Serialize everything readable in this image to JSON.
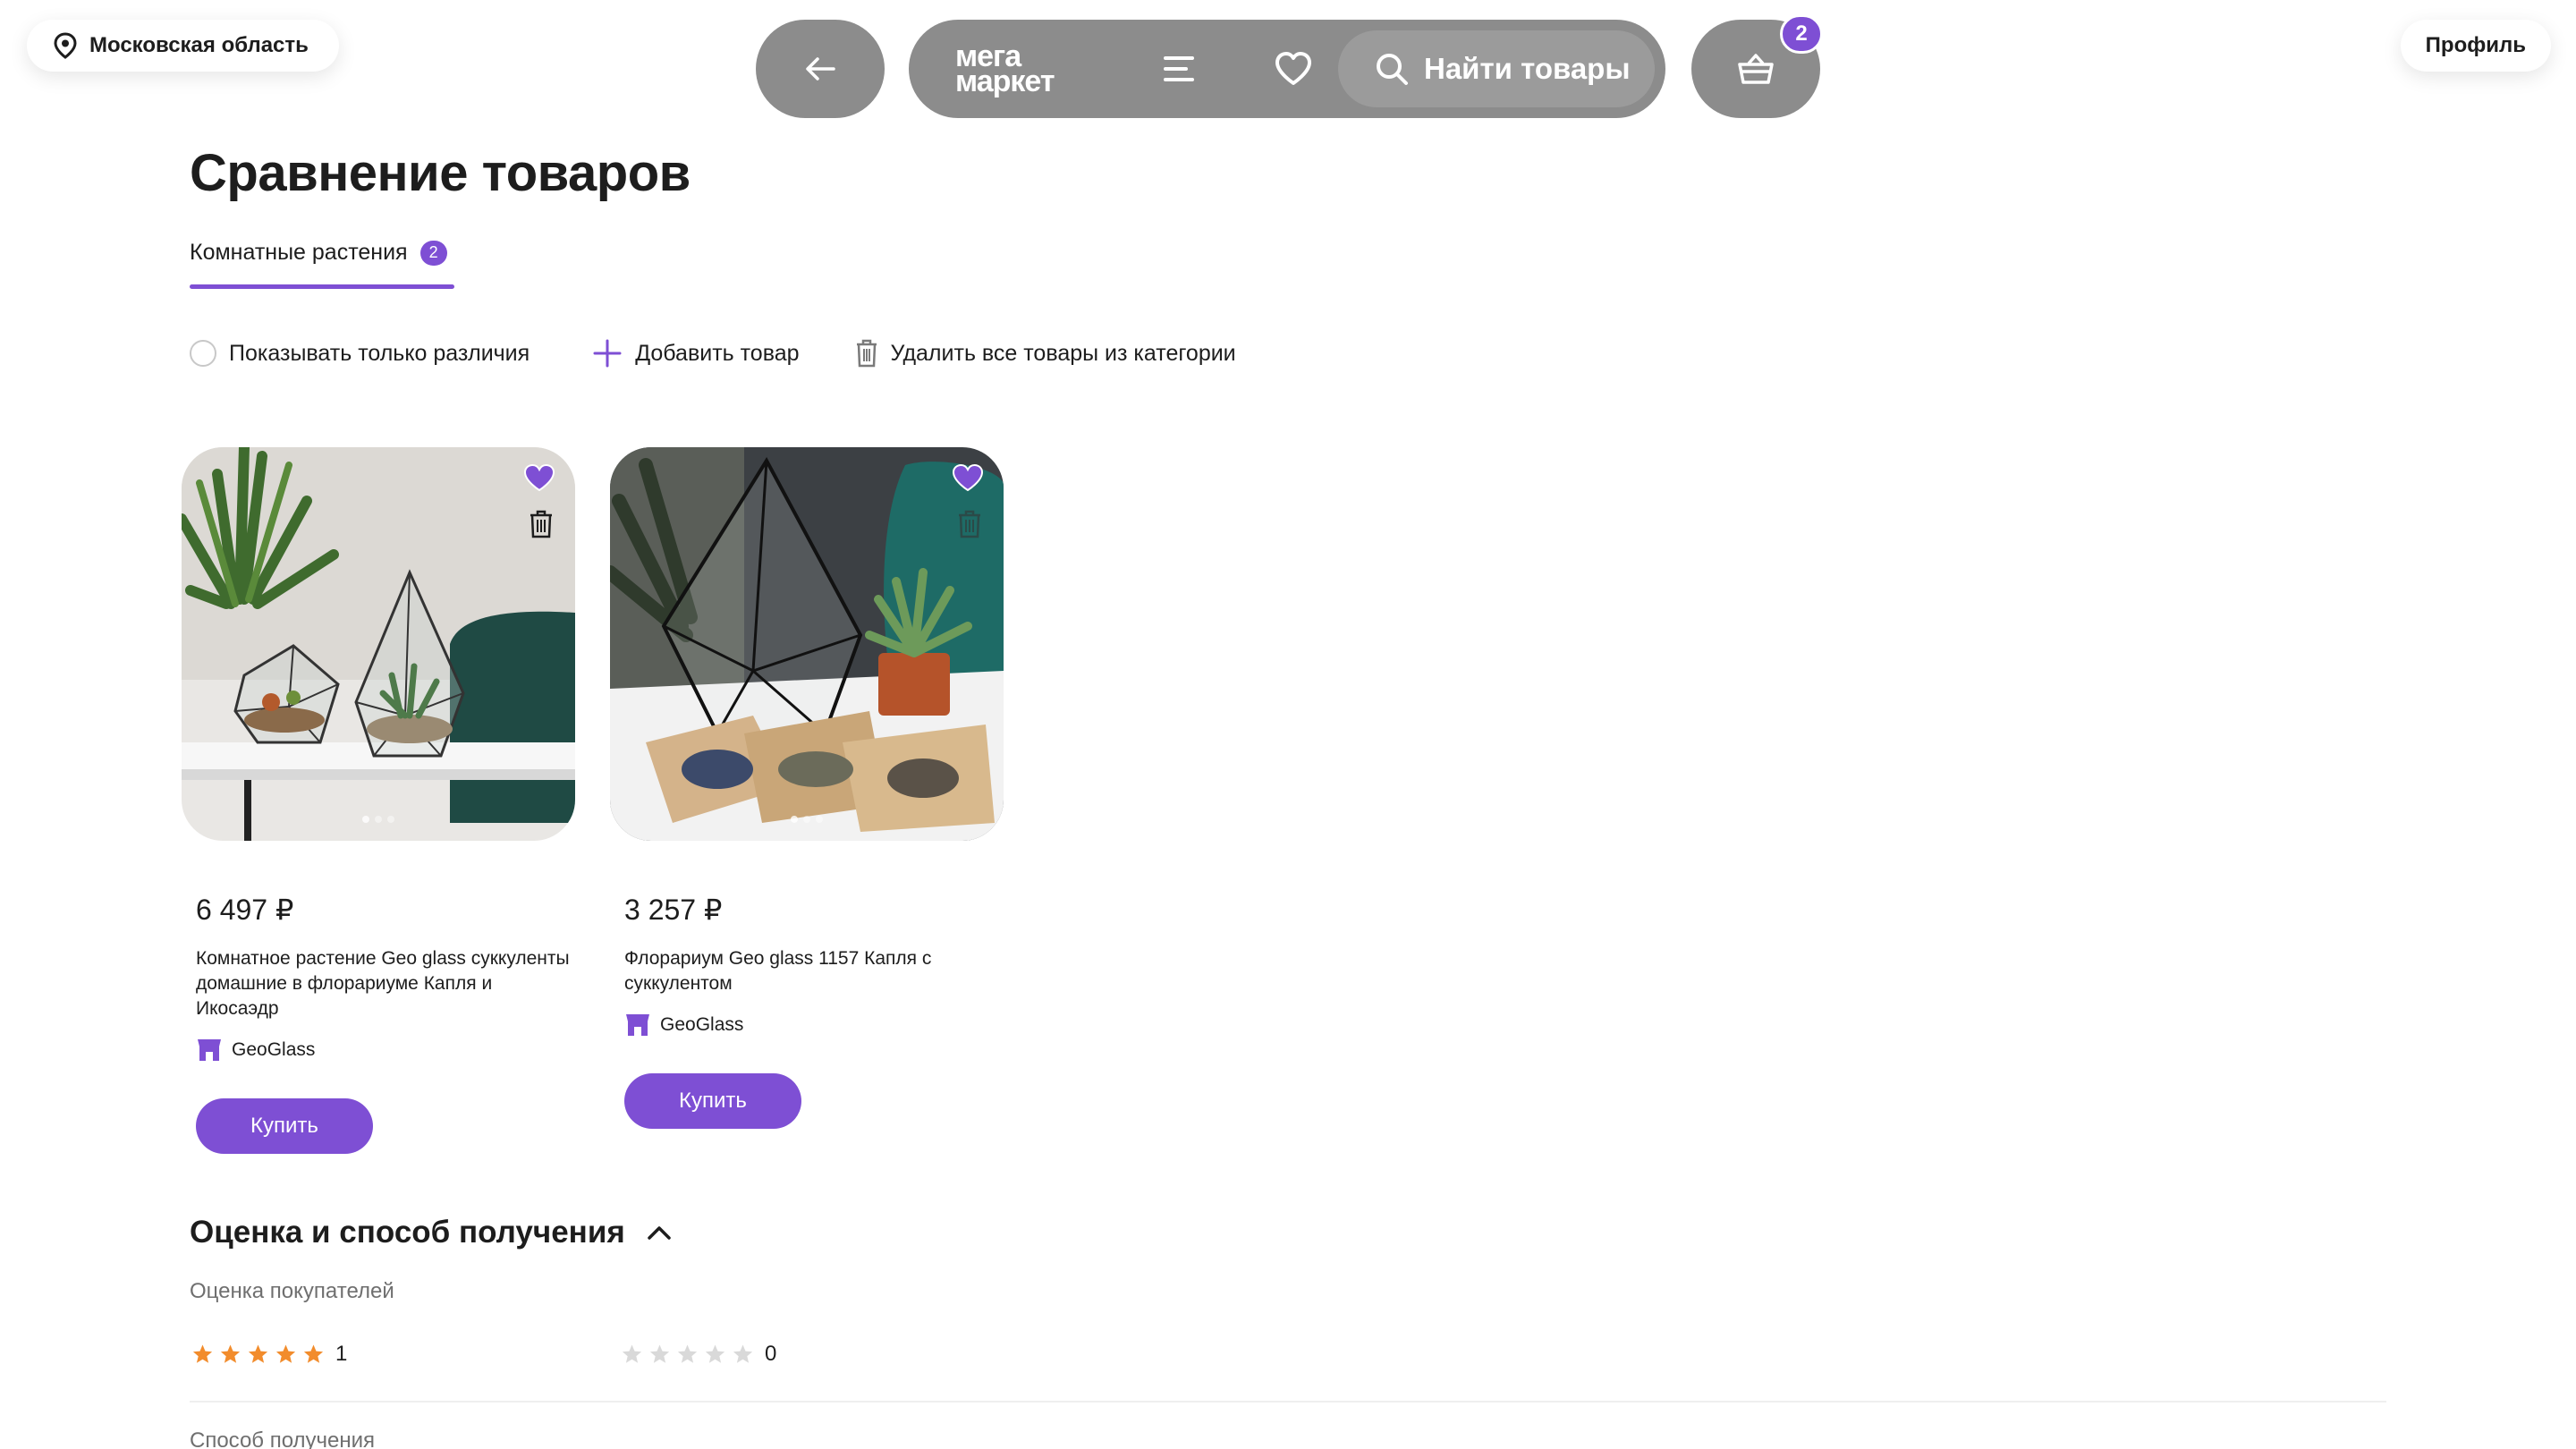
{
  "header": {
    "region": "Московская область",
    "profile": "Профиль",
    "logo_line1": "мега",
    "logo_line2": "маркет",
    "search_placeholder": "Найти товары",
    "cart_count": "2"
  },
  "page": {
    "title": "Сравнение товаров",
    "tab_label": "Комнатные растения",
    "tab_count": "2"
  },
  "controls": {
    "only_diff": "Показывать только различия",
    "add_product": "Добавить товар",
    "delete_all": "Удалить все товары из категории"
  },
  "products": [
    {
      "price": "6 497 ₽",
      "name": "Комнатное растение Geo glass суккуленты домашние в флорариуме Капля и Икосаэдр",
      "seller": "GeoGlass",
      "buy": "Купить",
      "rating_count": "1",
      "rating_stars": 5
    },
    {
      "price": "3 257 ₽",
      "name": "Флорариум Geo glass 1157 Капля с суккулентом",
      "seller": "GeoGlass",
      "buy": "Купить",
      "rating_count": "0",
      "rating_stars": 0
    }
  ],
  "section": {
    "title": "Оценка и способ получения",
    "rating_label": "Оценка покупателей",
    "delivery_label": "Способ получения"
  },
  "colors": {
    "accent": "#7e4fd4",
    "nav_bg": "#8c8c8c",
    "star_filled": "#f28c2c",
    "star_empty": "#d9d9d9"
  }
}
